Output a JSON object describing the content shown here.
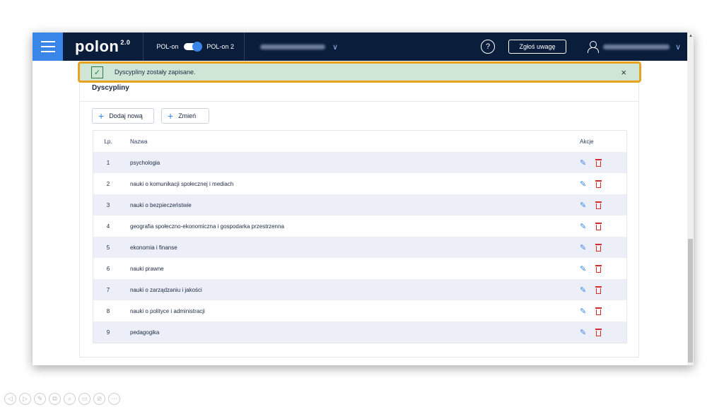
{
  "topbar": {
    "logo": "polon",
    "logo_version": "2.0",
    "switch_left": "POL-on",
    "switch_right": "POL-on 2",
    "help_label": "?",
    "report_button": "Zgłoś uwagę"
  },
  "toast": {
    "message": "Dyscypliny zostały zapisane.",
    "close_label": "×",
    "check_label": "✓"
  },
  "panel": {
    "title": "Dyscypliny",
    "add_button": "Dodaj nową",
    "change_button": "Zmień"
  },
  "table": {
    "headers": {
      "lp": "Lp.",
      "name": "Nazwa",
      "actions": "Akcje"
    },
    "rows": [
      {
        "lp": "1",
        "name": "psychologia"
      },
      {
        "lp": "2",
        "name": "nauki o komunikacji społecznej i mediach"
      },
      {
        "lp": "3",
        "name": "nauki o bezpieczeństwie"
      },
      {
        "lp": "4",
        "name": "geografia społeczno-ekonomiczna i gospodarka przestrzenna"
      },
      {
        "lp": "5",
        "name": "ekonomia i finanse"
      },
      {
        "lp": "6",
        "name": "nauki prawne"
      },
      {
        "lp": "7",
        "name": "nauki o zarządzaniu i jakości"
      },
      {
        "lp": "8",
        "name": "nauki o polityce i administracji"
      },
      {
        "lp": "9",
        "name": "pedagogika"
      }
    ]
  },
  "colors": {
    "topbar": "#0a1d3b",
    "accent": "#3a86e8",
    "toast_bg": "#cfe6d6",
    "toast_border": "#e8a31d",
    "delete": "#d42b2b"
  }
}
